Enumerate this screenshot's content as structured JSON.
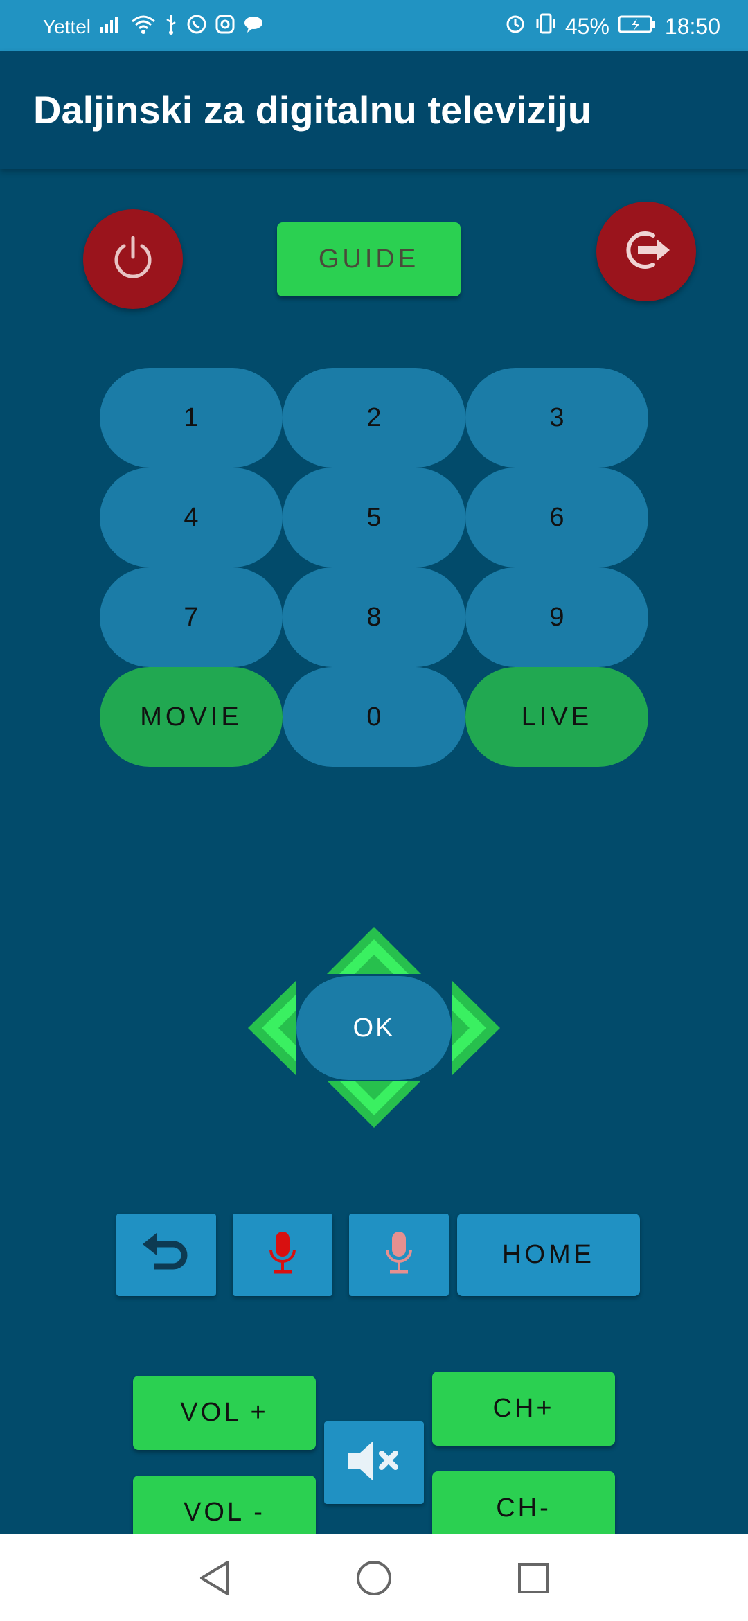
{
  "status_bar": {
    "carrier": "Yettel",
    "battery": "45%",
    "time": "18:50",
    "icons": [
      "signal-icon",
      "wifi-icon",
      "usb-icon",
      "whatsapp-icon",
      "instagram-icon",
      "chat-icon",
      "alarm-icon",
      "vibrate-icon",
      "battery-charging-icon"
    ]
  },
  "app_bar": {
    "title": "Daljinski za digitalnu televiziju"
  },
  "top_row": {
    "power_icon": "power-icon",
    "guide_label": "GUIDE",
    "exit_icon": "exit-icon"
  },
  "keypad": {
    "keys": [
      "1",
      "2",
      "3",
      "4",
      "5",
      "6",
      "7",
      "8",
      "9",
      "MOVIE",
      "0",
      "LIVE"
    ]
  },
  "dpad": {
    "ok_label": "OK"
  },
  "function_row": {
    "back_icon": "back-icon",
    "mic_icon": "microphone-icon",
    "mic_off_icon": "microphone-faded-icon",
    "home_label": "HOME"
  },
  "volume_channel": {
    "vol_up": "VOL +",
    "vol_down": "VOL -",
    "mute_icon": "mute-icon",
    "ch_up": "CH+",
    "ch_down": "CH-"
  },
  "nav_bar": {
    "icons": [
      "back-triangle-icon",
      "home-circle-icon",
      "recents-square-icon"
    ]
  },
  "colors": {
    "background": "#024b6b",
    "status_bar": "#2193c2",
    "key_blue": "#1b7ca7",
    "key_green": "#21a851",
    "button_green": "#2bd051",
    "power_red": "#9a141c",
    "arrow_green": "#2ee65c"
  }
}
